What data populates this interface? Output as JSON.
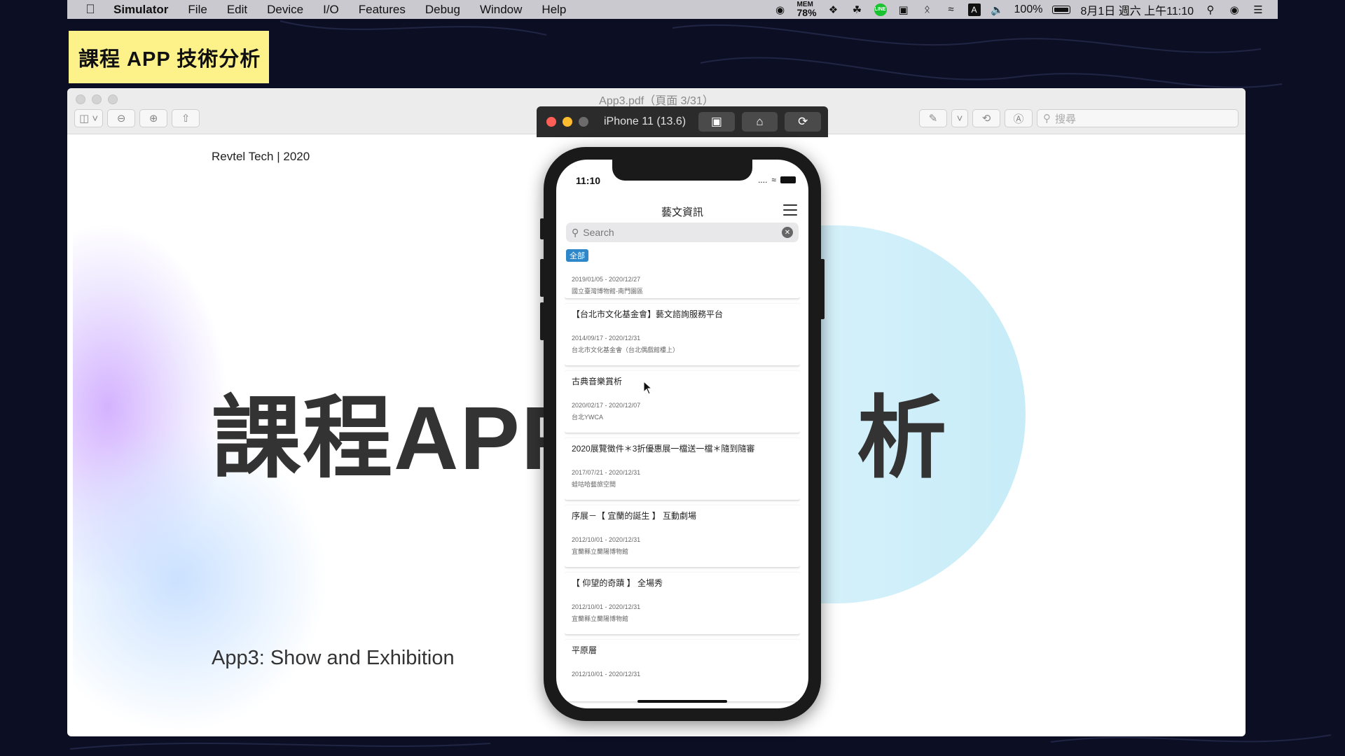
{
  "menubar": {
    "app": "Simulator",
    "items": [
      "File",
      "Edit",
      "Device",
      "I/O",
      "Features",
      "Debug",
      "Window",
      "Help"
    ],
    "mem_label": "MEM",
    "mem_value": "78%",
    "line_badge": "LINE",
    "input_method": "A",
    "battery": "100%",
    "datetime": "8月1日 週六 上午11:10"
  },
  "course_label": "課程 APP 技術分析",
  "preview": {
    "title": "App3.pdf（頁面 3/31）",
    "search_placeholder": "搜尋"
  },
  "slide": {
    "header": "Revtel Tech | 2020",
    "title_left": "課程APP",
    "title_right": "析",
    "subtitle": "App3: Show and Exhibition"
  },
  "simulator": {
    "device": "iPhone 11 (13.6)"
  },
  "app": {
    "status_time": "11:10",
    "status_signal": "....",
    "title": "藝文資訊",
    "search_placeholder": "Search",
    "filter_chip": "全部",
    "events": [
      {
        "title": "",
        "date": "2019/01/05 - 2020/12/27",
        "location": "國立臺灣博物館-南門園區"
      },
      {
        "title": "【台北市文化基金會】藝文諮詢服務平台",
        "date": "2014/09/17 - 2020/12/31",
        "location": "台北市文化基金會（台北偶戲館樓上）"
      },
      {
        "title": "古典音樂賞析",
        "date": "2020/02/17 - 2020/12/07",
        "location": "台北YWCA"
      },
      {
        "title": "2020展覽徵件＊3折優惠展一檔送一檔＊隨到隨審",
        "date": "2017/07/21 - 2020/12/31",
        "location": "蛙咕哈藝旅空間"
      },
      {
        "title": "序展－【 宜蘭的誕生 】 互動劇場",
        "date": "2012/10/01 - 2020/12/31",
        "location": "宜蘭縣立蘭陽博物館"
      },
      {
        "title": "【 仰望的奇蹟 】 全場秀",
        "date": "2012/10/01 - 2020/12/31",
        "location": "宜蘭縣立蘭陽博物館"
      },
      {
        "title": "平原層",
        "date": "2012/10/01 - 2020/12/31",
        "location": ""
      }
    ]
  },
  "colors": {
    "chip_blue": "#2d87c8",
    "label_yellow": "#fdf28a",
    "close_red": "#ff5f57",
    "minimize_yellow": "#febc2e",
    "zoom_gray": "#6b6b6b"
  }
}
